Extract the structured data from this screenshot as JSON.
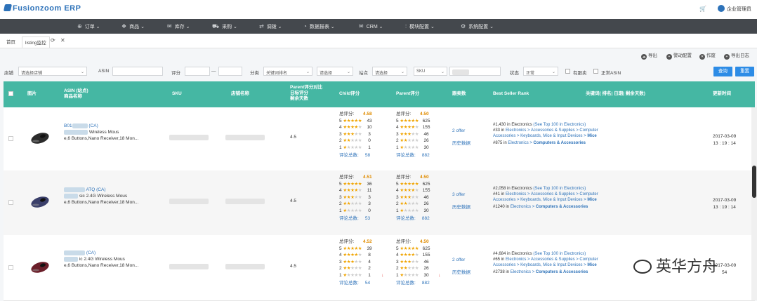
{
  "app": {
    "logo": "Fusionzoom ERP",
    "user": "企业管理员"
  },
  "nav": [
    {
      "label": "订单",
      "icon": "cart-icon"
    },
    {
      "label": "商品",
      "icon": "box-icon"
    },
    {
      "label": "库存",
      "icon": "mail-icon"
    },
    {
      "label": "采购",
      "icon": "truck-icon"
    },
    {
      "label": "调拨",
      "icon": "transfer-icon"
    },
    {
      "label": "数据报表",
      "icon": "chart-icon"
    },
    {
      "label": "CRM",
      "icon": "envelope-icon"
    },
    {
      "label": "模块配置",
      "icon": "sliders-icon"
    },
    {
      "label": "系统配置",
      "icon": "gear-icon"
    }
  ],
  "tabs": {
    "home": "首页",
    "current": "listing监控"
  },
  "actions": {
    "export": "导出",
    "alarm": "警动配置",
    "job": "作废",
    "export_log": "导出日志"
  },
  "filters": {
    "shop_label": "店铺",
    "shop_value": "请选择店铺",
    "asin_label": "ASIN",
    "rating_label": "评分",
    "range_dash": "—",
    "category_label": "分类",
    "category_value": "关键词排名",
    "category_select": "请选择",
    "site_label": "站点",
    "site_value": "请选择",
    "sku_value": "SKU",
    "status_label": "状态",
    "status_value": "正常",
    "has_offer_label": "有跟卖",
    "abnormal_label": "正常ASIN",
    "query_btn": "查询",
    "reset_btn": "重置"
  },
  "table": {
    "headers": {
      "image": "图片",
      "asin": "ASIN (站点)",
      "product": "商品名称",
      "sku": "SKU",
      "shop": "店铺名称",
      "parent_l1": "Parent评分对比",
      "parent_l2": "日标评分",
      "parent_l3": "剩余天数",
      "child": "Child评分",
      "parent": "Parent评分",
      "offer": "跟卖数",
      "bsr": "Best Seller Rank",
      "kw": "关键词( 排名| 日期| 剩余天数)",
      "time": "更新时间"
    },
    "rows": [
      {
        "asin_prefix": "B01",
        "asin_suffix": "(CA)",
        "title1": "Wireless Mous",
        "title2": "e,6 Buttons,Nano Receiver,18 Mon...",
        "parent_compare": "4.5",
        "child": {
          "total_label": "总评分:",
          "total": "4.58",
          "counts": [
            "43",
            "10",
            "3",
            "0",
            "1"
          ],
          "reviews_label": "评论总数:",
          "reviews": "58"
        },
        "parent": {
          "total_label": "总评分:",
          "total": "4.50",
          "counts": [
            "625",
            "155",
            "46",
            "26",
            "30"
          ],
          "reviews_label": "评论总数:",
          "reviews": "882"
        },
        "offer": "2 offer",
        "history": "历史数据",
        "bsr1": {
          "rank": "#1,430 in Electronics",
          "link": "(See Top 100 in Electronics)"
        },
        "bsr2": {
          "rank": "#33 in",
          "path": "Electronics > Accessories & Supplies > Computer Accessories > Keyboards, Mice & Input Devices > ",
          "leaf": "Mice"
        },
        "bsr3": {
          "rank": "#875 in",
          "path": "Electronics > ",
          "leaf": "Computers & Accessories"
        },
        "date": "2017-03-09",
        "time": "13 : 19 : 14",
        "down_child": "",
        "down_parent": ""
      },
      {
        "asin_prefix": "",
        "asin_suffix": "ATQ   (CA)",
        "title1": "sic 2.4G Wireless Mous",
        "title2": "e,6 Buttons,Nano Receiver,18 Mon...",
        "parent_compare": "4.5",
        "child": {
          "total_label": "总评分:",
          "total": "4.51",
          "counts": [
            "36",
            "11",
            "3",
            "3",
            "0"
          ],
          "reviews_label": "评论总数:",
          "reviews": "53"
        },
        "parent": {
          "total_label": "总评分:",
          "total": "4.50",
          "counts": [
            "625",
            "155",
            "46",
            "26",
            "30"
          ],
          "reviews_label": "评论总数:",
          "reviews": "882"
        },
        "offer": "3 offer",
        "history": "历史数据",
        "bsr1": {
          "rank": "#2,058 in Electronics",
          "link": "(See Top 100 in Electronics)"
        },
        "bsr2": {
          "rank": "#41 in",
          "path": "Electronics > Accessories & Supplies > Computer Accessories > Keyboards, Mice & Input Devices > ",
          "leaf": "Mice"
        },
        "bsr3": {
          "rank": "#1240 in",
          "path": "Electronics > ",
          "leaf": "Computers & Accessories"
        },
        "date": "2017-03-09",
        "time": "13 : 19 : 14",
        "down_child": "",
        "down_parent": ""
      },
      {
        "asin_prefix": "",
        "asin_suffix": "(CA)",
        "title1": "ic 2.4G Wireless Mous",
        "title2": "e,6 Buttons,Nano Receiver,18 Mon...",
        "parent_compare": "4.5",
        "child": {
          "total_label": "总评分:",
          "total": "4.52",
          "counts": [
            "39",
            "8",
            "4",
            "2",
            "1"
          ],
          "reviews_label": "评论总数:",
          "reviews": "54"
        },
        "parent": {
          "total_label": "总评分:",
          "total": "4.50",
          "counts": [
            "625",
            "155",
            "46",
            "26",
            "30"
          ],
          "reviews_label": "评论总数:",
          "reviews": "882"
        },
        "offer": "2 offer",
        "history": "历史数据",
        "bsr1": {
          "rank": "#4,684 in Electronics",
          "link": "(See Top 100 in Electronics)"
        },
        "bsr2": {
          "rank": "#65 in",
          "path": "Electronics > Accessories & Supplies > Computer Accessories > Keyboards, Mice & Input Devices > ",
          "leaf": "Mice"
        },
        "bsr3": {
          "rank": "#2738 in",
          "path": "Electronics > ",
          "leaf": "Computers & Accessories"
        },
        "date": "2017-03-09",
        "time": "54",
        "down_child": "↓",
        "down_parent": "↓"
      }
    ]
  },
  "watermark": "英华方舟"
}
